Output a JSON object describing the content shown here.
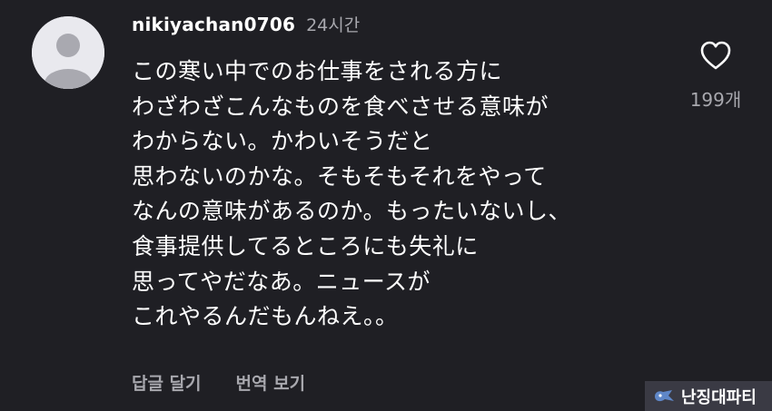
{
  "comment": {
    "username": "nikiyachan0706",
    "timestamp": "24시간",
    "lines": [
      "この寒い中でのお仕事をされる方に",
      "わざわざこんなものを食べさせる意味が",
      "わからない。かわいそうだと",
      "思わないのかな。そもそもそれをやって",
      "なんの意味があるのか。もったいないし、",
      "食事提供してるところにも失礼に",
      "思ってやだなあ。ニュースが",
      "これやるんだもんねえ。。"
    ],
    "actions": {
      "reply": "답글 달기",
      "translate": "번역 보기"
    },
    "likes": {
      "count": "199개"
    }
  },
  "watermark": {
    "text": "난징대파티"
  },
  "colors": {
    "background": "#1f1f24",
    "text": "#ffffff",
    "muted": "#a8a8ae",
    "avatar": "#e9e9ee"
  }
}
